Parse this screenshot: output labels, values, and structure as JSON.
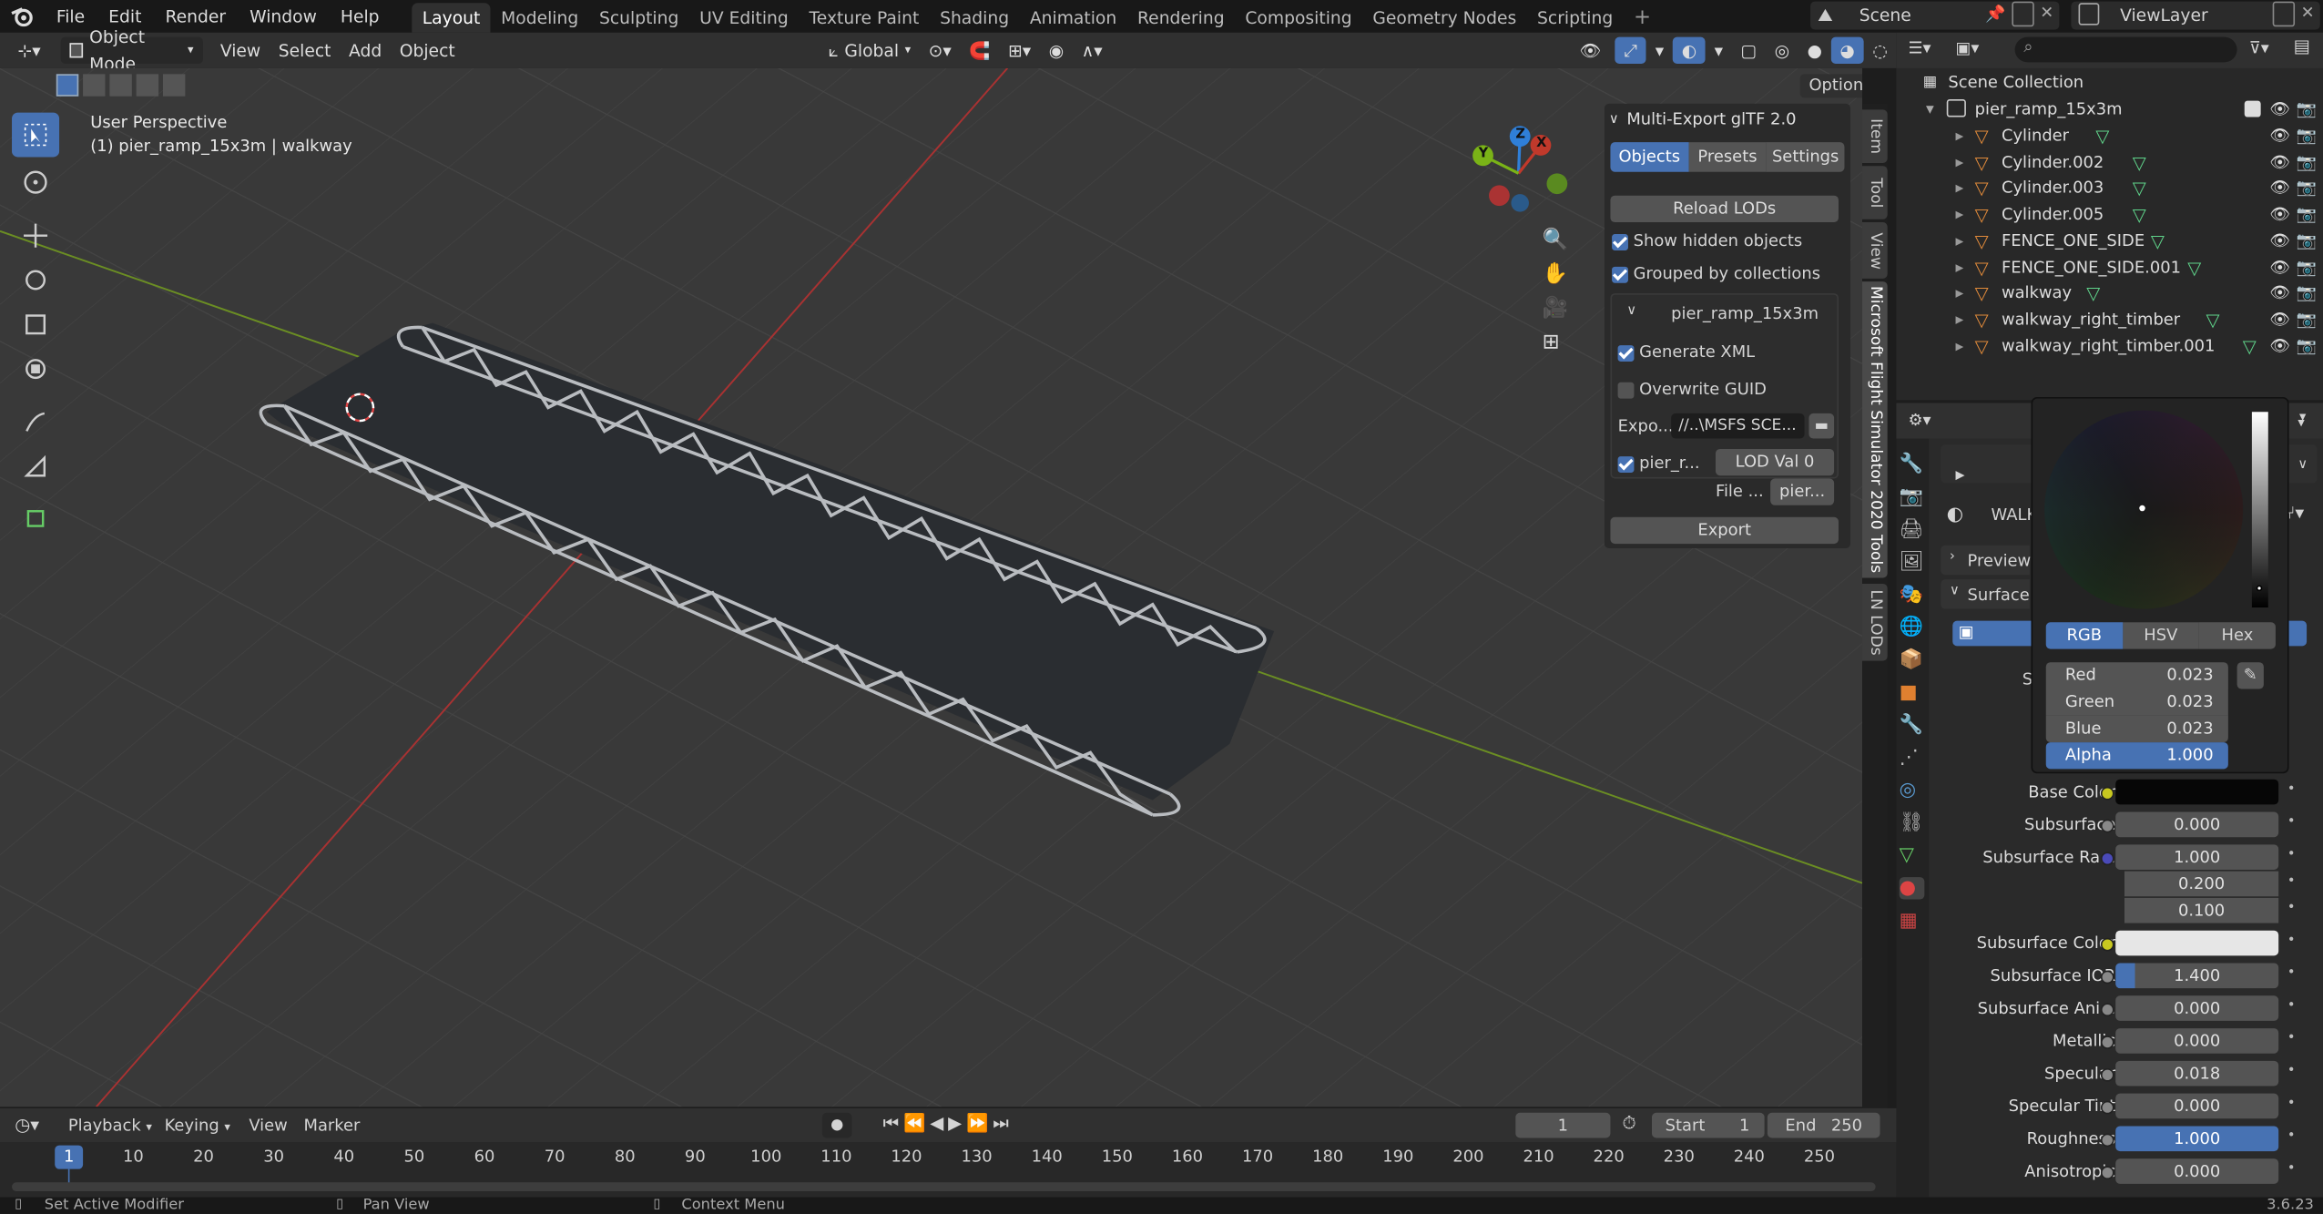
{
  "menu": {
    "items": [
      "File",
      "Edit",
      "Render",
      "Window",
      "Help"
    ]
  },
  "workspaces": [
    "Layout",
    "Modeling",
    "Sculpting",
    "UV Editing",
    "Texture Paint",
    "Shading",
    "Animation",
    "Rendering",
    "Compositing",
    "Geometry Nodes",
    "Scripting"
  ],
  "scene_name": "Scene",
  "view_layer": "ViewLayer",
  "header": {
    "mode": "Object Mode",
    "view": "View",
    "select": "Select",
    "add": "Add",
    "object": "Object",
    "transform_orientation": "Global",
    "options": "Options"
  },
  "viewport": {
    "perspective": "User Perspective",
    "object_info": "(1) pier_ramp_15x3m | walkway"
  },
  "gizmo": {
    "x": "X",
    "y": "Y",
    "z": "Z"
  },
  "npanel": {
    "title": "Multi-Export glTF 2.0",
    "tabs": [
      "Objects",
      "Presets",
      "Settings"
    ],
    "reload": "Reload LODs",
    "show_hidden": "Show hidden objects",
    "grouped": "Grouped by collections",
    "collection": "pier_ramp_15x3m",
    "generate_xml": "Generate XML",
    "overwrite_guid": "Overwrite GUID",
    "export_label": "Expo...",
    "export_path": "//..\\MSFS SCE...",
    "lod_obj": "pier_r...",
    "lod_val_label": "LOD Val",
    "lod_val": "0",
    "file_label": "File ...",
    "file_value": "pier...",
    "export_btn": "Export"
  },
  "side_tabs": [
    "Item",
    "Tool",
    "View",
    "Microsoft Flight Simulator 2020 Tools",
    "LN LODs"
  ],
  "outliner": {
    "root": "Scene Collection",
    "collection": "pier_ramp_15x3m",
    "objects": [
      "Cylinder",
      "Cylinder.002",
      "Cylinder.003",
      "Cylinder.005",
      "FENCE_ONE_SIDE",
      "FENCE_ONE_SIDE.001",
      "walkway",
      "walkway_right_timber",
      "walkway_right_timber.001"
    ]
  },
  "props": {
    "material_name": "WALK",
    "preview": "Preview",
    "surface": "Surface",
    "s_label": "S",
    "rows": [
      {
        "label": "Base Color",
        "value": "",
        "dot": "#c8c820"
      },
      {
        "label": "Subsurface",
        "value": "0.000",
        "dot": "#888888"
      },
      {
        "label": "Subsurface Ra...",
        "value": "1.000",
        "dot": "#4a4ab8"
      },
      {
        "label": "",
        "value": "0.200",
        "dot": ""
      },
      {
        "label": "",
        "value": "0.100",
        "dot": ""
      },
      {
        "label": "Subsurface Color",
        "value": "",
        "dot": "#c8c820"
      },
      {
        "label": "Subsurface IOR",
        "value": "1.400",
        "dot": "#888888"
      },
      {
        "label": "Subsurface Ani...",
        "value": "0.000",
        "dot": "#888888"
      },
      {
        "label": "Metallic",
        "value": "0.000",
        "dot": "#888888"
      },
      {
        "label": "Specular",
        "value": "0.018",
        "dot": "#888888"
      },
      {
        "label": "Specular Tint",
        "value": "0.000",
        "dot": "#888888"
      },
      {
        "label": "Roughness",
        "value": "1.000",
        "dot": "#888888"
      },
      {
        "label": "Anisotropic",
        "value": "0.000",
        "dot": "#888888"
      }
    ]
  },
  "color_picker": {
    "modes": [
      "RGB",
      "HSV",
      "Hex"
    ],
    "red_label": "Red",
    "red": "0.023",
    "green_label": "Green",
    "green": "0.023",
    "blue_label": "Blue",
    "blue": "0.023",
    "alpha_label": "Alpha",
    "alpha": "1.000"
  },
  "timeline": {
    "playback": "Playback",
    "keying": "Keying",
    "view": "View",
    "marker": "Marker",
    "current_frame": "1",
    "start_label": "Start",
    "start": "1",
    "end_label": "End",
    "end": "250",
    "ticks": [
      "1",
      "10",
      "20",
      "30",
      "40",
      "50",
      "60",
      "70",
      "80",
      "90",
      "100",
      "110",
      "120",
      "130",
      "140",
      "150",
      "160",
      "170",
      "180",
      "190",
      "200",
      "210",
      "220",
      "230",
      "240",
      "250"
    ]
  },
  "status": {
    "left": "Set Active Modifier",
    "middle": "Pan View",
    "right": "Context Menu",
    "version": "3.6.23"
  },
  "colors": {
    "accent": "#4772b3",
    "x_axis": "#c0392b",
    "y_axis": "#7ab317",
    "z_axis": "#2f7fd8"
  }
}
